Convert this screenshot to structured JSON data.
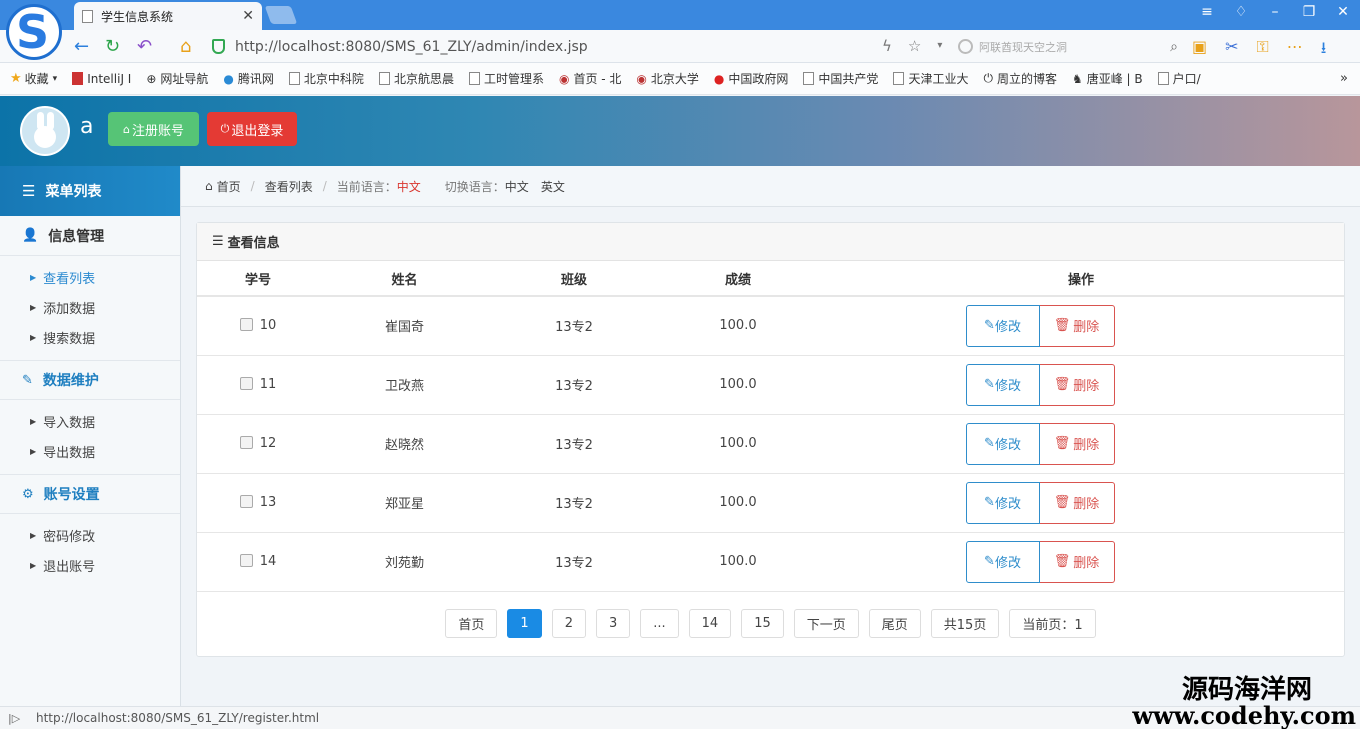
{
  "browser": {
    "tab_title": "学生信息系统",
    "url": "http://localhost:8080/SMS_61_ZLY/admin/index.jsp",
    "search_placeholder": "阿联酋现天空之洞",
    "bookmarks": [
      "收藏",
      "IntelliJ I",
      "网址导航",
      "腾讯网",
      "北京中科院",
      "北京航思晨",
      "工时管理系",
      "首页 - 北",
      "北京大学",
      "中国政府网",
      "中国共产党",
      "天津工业大",
      "周立的博客",
      "唐亚峰 | B",
      "户口/"
    ],
    "status_url": "http://localhost:8080/SMS_61_ZLY/register.html"
  },
  "header": {
    "username": "a",
    "register_label": "注册账号",
    "logout_label": "退出登录"
  },
  "sidebar": {
    "menu_title": "菜单列表",
    "groups": [
      {
        "label": "信息管理",
        "items": [
          "查看列表",
          "添加数据",
          "搜索数据"
        ]
      },
      {
        "label": "数据维护",
        "items": [
          "导入数据",
          "导出数据"
        ]
      },
      {
        "label": "账号设置",
        "items": [
          "密码修改",
          "退出账号"
        ]
      }
    ],
    "active_item": "查看列表"
  },
  "breadcrumb": {
    "home": "首页",
    "current": "查看列表",
    "lang_label": "当前语言：",
    "lang_value": "中文",
    "switch_label": "切换语言：",
    "switch_zh": "中文",
    "switch_en": "英文"
  },
  "panel": {
    "title": "查看信息",
    "columns": [
      "学号",
      "姓名",
      "班级",
      "成绩",
      "操作"
    ],
    "rows": [
      {
        "id": "10",
        "name": "崔国奇",
        "class": "13专2",
        "score": "100.0"
      },
      {
        "id": "11",
        "name": "卫改燕",
        "class": "13专2",
        "score": "100.0"
      },
      {
        "id": "12",
        "name": "赵晓然",
        "class": "13专2",
        "score": "100.0"
      },
      {
        "id": "13",
        "name": "郑亚星",
        "class": "13专2",
        "score": "100.0"
      },
      {
        "id": "14",
        "name": "刘苑勤",
        "class": "13专2",
        "score": "100.0"
      }
    ],
    "edit_label": "修改",
    "delete_label": "删除"
  },
  "pagination": {
    "first": "首页",
    "pages": [
      "1",
      "2",
      "3",
      "...",
      "14",
      "15"
    ],
    "active_page": "1",
    "next": "下一页",
    "last": "尾页",
    "total": "共15页",
    "current": "当前页：1"
  },
  "watermark": {
    "cn": "源码海洋网",
    "en": "www.codehy.com"
  },
  "colors": {
    "accent": "#1a8be4",
    "register_green": "#56c476",
    "logout_red": "#e43a34",
    "edit_blue": "#2f8dcb",
    "delete_red": "#d9534f"
  }
}
